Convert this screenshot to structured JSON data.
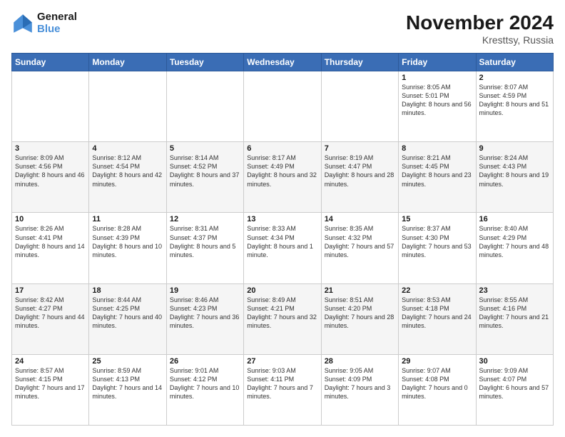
{
  "header": {
    "logo_line1": "General",
    "logo_line2": "Blue",
    "title": "November 2024",
    "subtitle": "Kresttsy, Russia"
  },
  "days_of_week": [
    "Sunday",
    "Monday",
    "Tuesday",
    "Wednesday",
    "Thursday",
    "Friday",
    "Saturday"
  ],
  "weeks": [
    [
      {
        "day": "",
        "info": ""
      },
      {
        "day": "",
        "info": ""
      },
      {
        "day": "",
        "info": ""
      },
      {
        "day": "",
        "info": ""
      },
      {
        "day": "",
        "info": ""
      },
      {
        "day": "1",
        "info": "Sunrise: 8:05 AM\nSunset: 5:01 PM\nDaylight: 8 hours and 56 minutes."
      },
      {
        "day": "2",
        "info": "Sunrise: 8:07 AM\nSunset: 4:59 PM\nDaylight: 8 hours and 51 minutes."
      }
    ],
    [
      {
        "day": "3",
        "info": "Sunrise: 8:09 AM\nSunset: 4:56 PM\nDaylight: 8 hours and 46 minutes."
      },
      {
        "day": "4",
        "info": "Sunrise: 8:12 AM\nSunset: 4:54 PM\nDaylight: 8 hours and 42 minutes."
      },
      {
        "day": "5",
        "info": "Sunrise: 8:14 AM\nSunset: 4:52 PM\nDaylight: 8 hours and 37 minutes."
      },
      {
        "day": "6",
        "info": "Sunrise: 8:17 AM\nSunset: 4:49 PM\nDaylight: 8 hours and 32 minutes."
      },
      {
        "day": "7",
        "info": "Sunrise: 8:19 AM\nSunset: 4:47 PM\nDaylight: 8 hours and 28 minutes."
      },
      {
        "day": "8",
        "info": "Sunrise: 8:21 AM\nSunset: 4:45 PM\nDaylight: 8 hours and 23 minutes."
      },
      {
        "day": "9",
        "info": "Sunrise: 8:24 AM\nSunset: 4:43 PM\nDaylight: 8 hours and 19 minutes."
      }
    ],
    [
      {
        "day": "10",
        "info": "Sunrise: 8:26 AM\nSunset: 4:41 PM\nDaylight: 8 hours and 14 minutes."
      },
      {
        "day": "11",
        "info": "Sunrise: 8:28 AM\nSunset: 4:39 PM\nDaylight: 8 hours and 10 minutes."
      },
      {
        "day": "12",
        "info": "Sunrise: 8:31 AM\nSunset: 4:37 PM\nDaylight: 8 hours and 5 minutes."
      },
      {
        "day": "13",
        "info": "Sunrise: 8:33 AM\nSunset: 4:34 PM\nDaylight: 8 hours and 1 minute."
      },
      {
        "day": "14",
        "info": "Sunrise: 8:35 AM\nSunset: 4:32 PM\nDaylight: 7 hours and 57 minutes."
      },
      {
        "day": "15",
        "info": "Sunrise: 8:37 AM\nSunset: 4:30 PM\nDaylight: 7 hours and 53 minutes."
      },
      {
        "day": "16",
        "info": "Sunrise: 8:40 AM\nSunset: 4:29 PM\nDaylight: 7 hours and 48 minutes."
      }
    ],
    [
      {
        "day": "17",
        "info": "Sunrise: 8:42 AM\nSunset: 4:27 PM\nDaylight: 7 hours and 44 minutes."
      },
      {
        "day": "18",
        "info": "Sunrise: 8:44 AM\nSunset: 4:25 PM\nDaylight: 7 hours and 40 minutes."
      },
      {
        "day": "19",
        "info": "Sunrise: 8:46 AM\nSunset: 4:23 PM\nDaylight: 7 hours and 36 minutes."
      },
      {
        "day": "20",
        "info": "Sunrise: 8:49 AM\nSunset: 4:21 PM\nDaylight: 7 hours and 32 minutes."
      },
      {
        "day": "21",
        "info": "Sunrise: 8:51 AM\nSunset: 4:20 PM\nDaylight: 7 hours and 28 minutes."
      },
      {
        "day": "22",
        "info": "Sunrise: 8:53 AM\nSunset: 4:18 PM\nDaylight: 7 hours and 24 minutes."
      },
      {
        "day": "23",
        "info": "Sunrise: 8:55 AM\nSunset: 4:16 PM\nDaylight: 7 hours and 21 minutes."
      }
    ],
    [
      {
        "day": "24",
        "info": "Sunrise: 8:57 AM\nSunset: 4:15 PM\nDaylight: 7 hours and 17 minutes."
      },
      {
        "day": "25",
        "info": "Sunrise: 8:59 AM\nSunset: 4:13 PM\nDaylight: 7 hours and 14 minutes."
      },
      {
        "day": "26",
        "info": "Sunrise: 9:01 AM\nSunset: 4:12 PM\nDaylight: 7 hours and 10 minutes."
      },
      {
        "day": "27",
        "info": "Sunrise: 9:03 AM\nSunset: 4:11 PM\nDaylight: 7 hours and 7 minutes."
      },
      {
        "day": "28",
        "info": "Sunrise: 9:05 AM\nSunset: 4:09 PM\nDaylight: 7 hours and 3 minutes."
      },
      {
        "day": "29",
        "info": "Sunrise: 9:07 AM\nSunset: 4:08 PM\nDaylight: 7 hours and 0 minutes."
      },
      {
        "day": "30",
        "info": "Sunrise: 9:09 AM\nSunset: 4:07 PM\nDaylight: 6 hours and 57 minutes."
      }
    ]
  ]
}
